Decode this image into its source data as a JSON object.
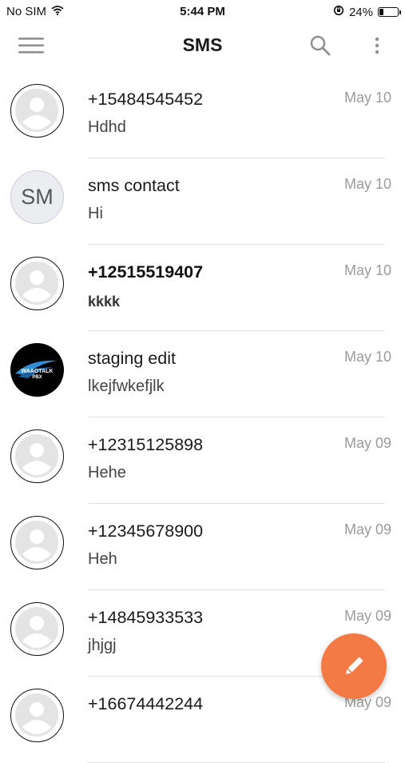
{
  "status_bar": {
    "carrier": "No SIM",
    "time": "5:44 PM",
    "battery": "24%",
    "battery_level": 0.24
  },
  "header": {
    "title": "SMS"
  },
  "icons": {
    "menu": "hamburger-menu-icon",
    "search": "search-icon",
    "more": "more-vertical-icon",
    "compose": "pencil-icon"
  },
  "colors": {
    "fab": "#f37a44",
    "date": "#9b9b9b",
    "divider": "#e1e1e1"
  },
  "conversations": [
    {
      "name": "+15484545452",
      "preview": "Hdhd",
      "date": "May 10",
      "avatar": "default",
      "unread": false
    },
    {
      "name": "sms contact",
      "preview": "Hi",
      "date": "May 10",
      "avatar": "initials",
      "initials": "SM",
      "unread": false
    },
    {
      "name": "+12515519407",
      "preview": "kkkk",
      "date": "May 10",
      "avatar": "default",
      "unread": true
    },
    {
      "name": "staging edit",
      "preview": "lkejfwkefjlk",
      "date": "May 10",
      "avatar": "logo",
      "logo_text": "WAAOTALK",
      "logo_sub": "PBX",
      "unread": false
    },
    {
      "name": "+12315125898",
      "preview": "Hehe",
      "date": "May 09",
      "avatar": "default",
      "unread": false
    },
    {
      "name": "+12345678900",
      "preview": "Heh",
      "date": "May 09",
      "avatar": "default",
      "unread": false
    },
    {
      "name": "+14845933533",
      "preview": "jhjgj",
      "date": "May 09",
      "avatar": "default",
      "unread": false
    },
    {
      "name": "+16674442244",
      "preview": "",
      "date": "May 09",
      "avatar": "default",
      "unread": false
    }
  ]
}
